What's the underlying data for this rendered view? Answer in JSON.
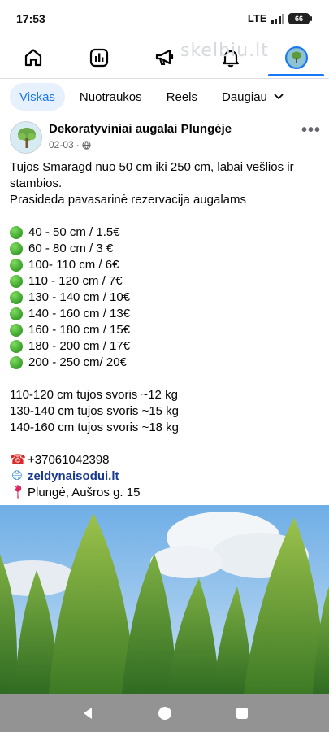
{
  "status_bar": {
    "time": "17:53",
    "network": "LTE",
    "battery": "66"
  },
  "watermark": "skelbiu.lt",
  "top_nav": {
    "items": [
      {
        "icon": "home-icon"
      },
      {
        "icon": "news-feed-icon"
      },
      {
        "icon": "megaphone-icon"
      },
      {
        "icon": "bell-icon"
      },
      {
        "icon": "profile-avatar",
        "active": true
      }
    ]
  },
  "filters": {
    "all": "Viskas",
    "photos": "Nuotraukos",
    "reels": "Reels",
    "more": "Daugiau"
  },
  "post": {
    "page_name": "Dekoratyviniai augalai Plungėje",
    "date": "02-03",
    "privacy_separator": "·",
    "intro_1": "Tujos Smaragd nuo 50 cm iki 250 cm, labai vešlios ir",
    "intro_2": "stambios.",
    "intro_3": "Prasideda pavasarinė rezervacija augalams",
    "prices": [
      "40 - 50 cm / 1.5€",
      "60 - 80 cm /  3 €",
      "100- 110 cm / 6€",
      "110 - 120 cm / 7€",
      "130 - 140 cm / 10€",
      "140 - 160 cm / 13€",
      "160 - 180 cm / 15€",
      "180 - 200 cm / 17€",
      "200 - 250 cm/ 20€"
    ],
    "weights": [
      "110-120 cm tujos svoris ~12 kg",
      "130-140 cm tujos svoris ~15 kg",
      "140-160 cm tujos svoris ~18 kg"
    ],
    "phone": "+37061042398",
    "website": "zeldynaisodui.lt",
    "address": "Plungė, Aušros g. 15"
  },
  "colors": {
    "accent": "#1877f2",
    "chip_bg": "#e7f0fd",
    "nav_bar": "#939393"
  }
}
